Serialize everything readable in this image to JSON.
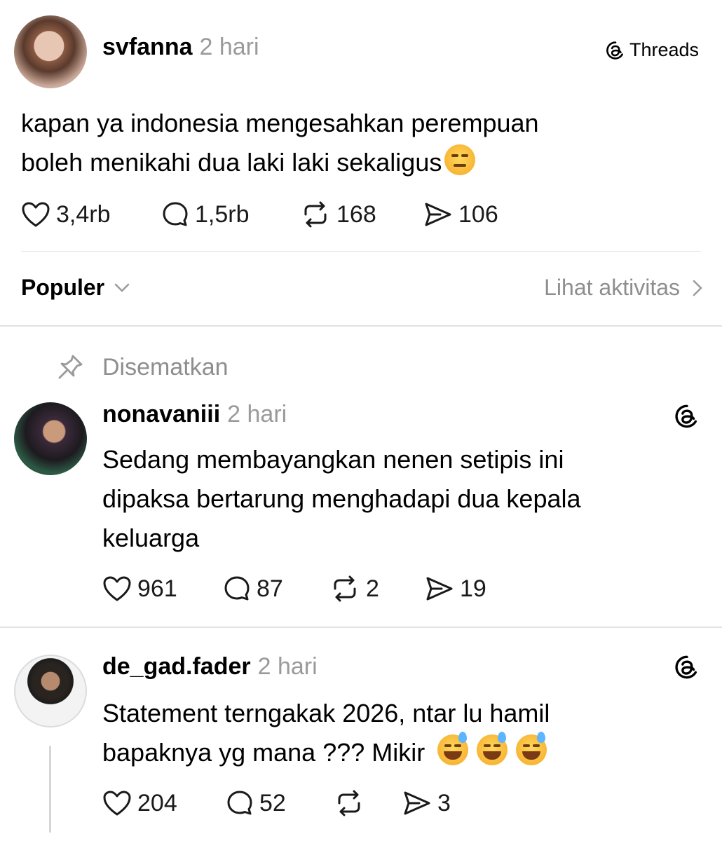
{
  "original_post": {
    "username": "svfanna",
    "time": "2 hari",
    "app_label": "Threads",
    "text_line1": "kapan ya indonesia mengesahkan perempuan",
    "text_line2": "boleh menikahi dua laki laki sekaligus",
    "likes": "3,4rb",
    "replies": "1,5rb",
    "reposts": "168",
    "shares": "106"
  },
  "sort_bar": {
    "sort_label": "Populer",
    "activity_label": "Lihat aktivitas"
  },
  "pinned_label": "Disematkan",
  "comments": [
    {
      "username": "nonavaniii",
      "time": "2 hari",
      "line1": "Sedang membayangkan nenen setipis ini",
      "line2": "dipaksa bertarung menghadapi dua kepala",
      "line3": "keluarga",
      "likes": "961",
      "replies": "87",
      "reposts": "2",
      "shares": "19"
    },
    {
      "username": "de_gad.fader",
      "time": "2 hari",
      "line1": "Statement terngakak 2026, ntar lu hamil",
      "line2": "bapaknya yg mana ??? Mikir",
      "likes": "204",
      "replies": "52",
      "reposts": "",
      "shares": "3"
    }
  ],
  "icons": {
    "like": "heart-icon",
    "reply": "speech-bubble-icon",
    "repost": "repost-arrows-icon",
    "share": "send-icon",
    "pin": "pin-icon",
    "threads": "threads-logo-icon"
  }
}
